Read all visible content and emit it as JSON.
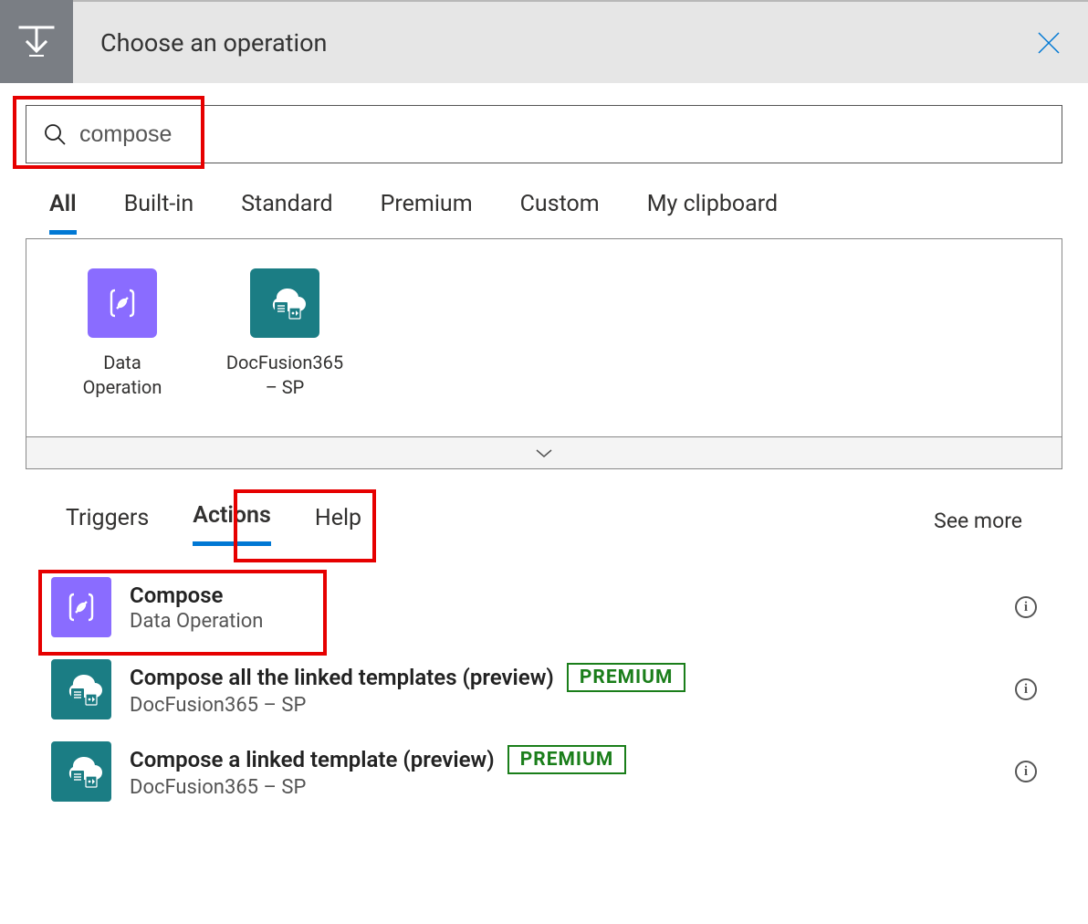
{
  "header": {
    "title": "Choose an operation"
  },
  "search": {
    "value": "compose"
  },
  "tabs": [
    {
      "label": "All",
      "active": true
    },
    {
      "label": "Built-in"
    },
    {
      "label": "Standard"
    },
    {
      "label": "Premium"
    },
    {
      "label": "Custom"
    },
    {
      "label": "My clipboard"
    }
  ],
  "connectors": [
    {
      "label": "Data Operation",
      "icon": "dataop"
    },
    {
      "label": "DocFusion365 – SP",
      "icon": "docfusion"
    }
  ],
  "subtabs": [
    {
      "label": "Triggers"
    },
    {
      "label": "Actions",
      "active": true
    },
    {
      "label": "Help"
    }
  ],
  "see_more": "See more",
  "premium_label": "PREMIUM",
  "results": [
    {
      "title": "Compose",
      "sub": "Data Operation",
      "icon": "dataop",
      "premium": false
    },
    {
      "title": "Compose all the linked templates (preview)",
      "sub": "DocFusion365 – SP",
      "icon": "docfusion",
      "premium": true
    },
    {
      "title": "Compose a linked template (preview)",
      "sub": "DocFusion365 – SP",
      "icon": "docfusion",
      "premium": true
    }
  ]
}
